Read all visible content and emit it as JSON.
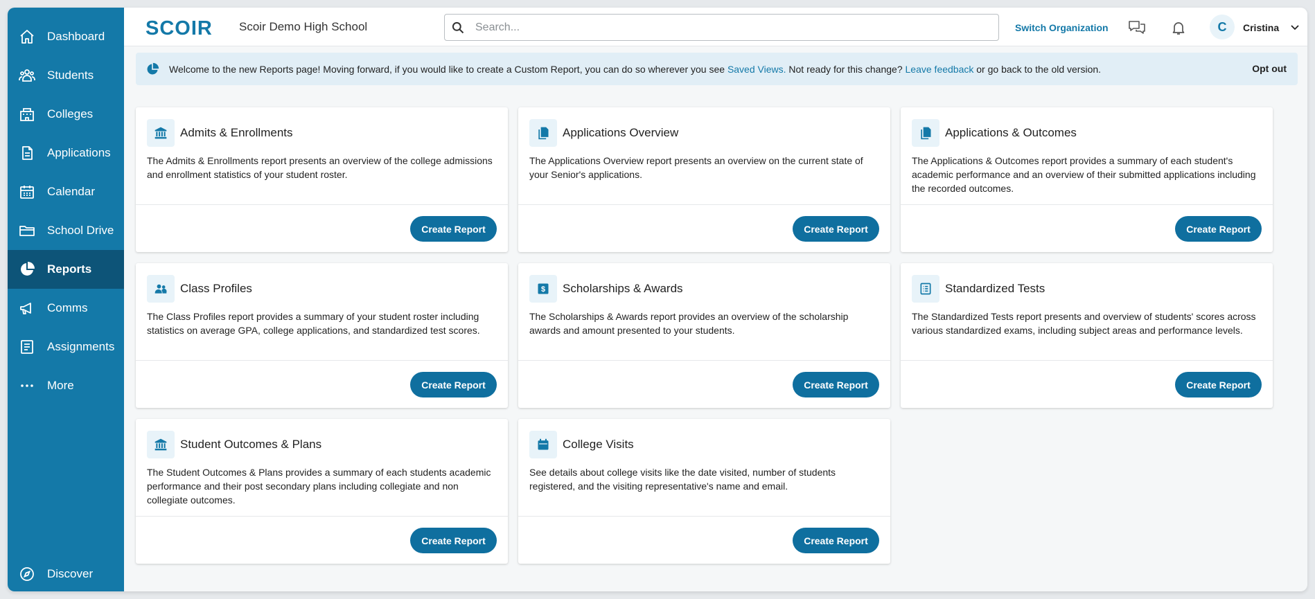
{
  "sidebar": {
    "items": [
      {
        "label": "Dashboard",
        "icon": "home-icon"
      },
      {
        "label": "Students",
        "icon": "students-icon"
      },
      {
        "label": "Colleges",
        "icon": "colleges-icon"
      },
      {
        "label": "Applications",
        "icon": "applications-icon"
      },
      {
        "label": "Calendar",
        "icon": "calendar-icon"
      },
      {
        "label": "School Drive",
        "icon": "folder-icon"
      },
      {
        "label": "Reports",
        "icon": "pie-chart-icon",
        "active": true
      },
      {
        "label": "Comms",
        "icon": "megaphone-icon"
      },
      {
        "label": "Assignments",
        "icon": "assignments-icon"
      },
      {
        "label": "More",
        "icon": "more-dots-icon"
      }
    ],
    "discover": {
      "label": "Discover",
      "icon": "compass-icon"
    }
  },
  "header": {
    "logo_text": "SCOIR",
    "school_name": "Scoir Demo High School",
    "search_placeholder": "Search...",
    "switch_org": "Switch Organization",
    "avatar_initial": "C",
    "user_name": "Cristina"
  },
  "banner": {
    "text_1": "Welcome to the new Reports page! Moving forward, if you would like to create a Custom Report, you can do so wherever you see ",
    "link_saved_views": "Saved Views.",
    "text_2": " Not ready for this change? ",
    "link_feedback": "Leave feedback",
    "text_3": " or go back to the old version.",
    "opt_out": "Opt out"
  },
  "cards": [
    {
      "title": "Admits & Enrollments",
      "icon": "bank-icon",
      "description": "The Admits & Enrollments report presents an overview of the college admissions and enrollment statistics of your student roster.",
      "button": "Create Report"
    },
    {
      "title": "Applications Overview",
      "icon": "documents-icon",
      "description": "The Applications Overview report presents an overview on the current state of your Senior's applications.",
      "button": "Create Report"
    },
    {
      "title": "Applications & Outcomes",
      "icon": "documents-icon",
      "description": "The Applications & Outcomes report provides a summary of each student's academic performance and an overview of their submitted applications including the recorded outcomes.",
      "button": "Create Report"
    },
    {
      "title": "Class Profiles",
      "icon": "people-icon",
      "description": "The Class Profiles report provides a summary of your student roster including statistics on average GPA, college applications, and standardized test scores.",
      "button": "Create Report"
    },
    {
      "title": "Scholarships & Awards",
      "icon": "dollar-icon",
      "description": "The Scholarships & Awards report provides an overview of the scholarship awards and amount presented to your students.",
      "button": "Create Report"
    },
    {
      "title": "Standardized Tests",
      "icon": "list-icon",
      "description": "The Standardized Tests report presents and overview of students' scores across various standardized exams, including subject areas and performance levels.",
      "button": "Create Report"
    },
    {
      "title": "Student Outcomes & Plans",
      "icon": "bank-icon",
      "description": "The Student Outcomes & Plans provides a summary of each students academic performance and their post secondary plans including collegiate and non collegiate outcomes.",
      "button": "Create Report"
    },
    {
      "title": "College Visits",
      "icon": "calendar-icon",
      "description": "See details about college visits like the date visited, number of students registered, and the visiting representative's name and email.",
      "button": "Create Report"
    }
  ],
  "colors": {
    "sidebar": "#1479a8",
    "sidebar_active": "#0d5478",
    "accent": "#1479a8",
    "button": "#0f6f9f",
    "banner_bg": "#e1eef6"
  }
}
